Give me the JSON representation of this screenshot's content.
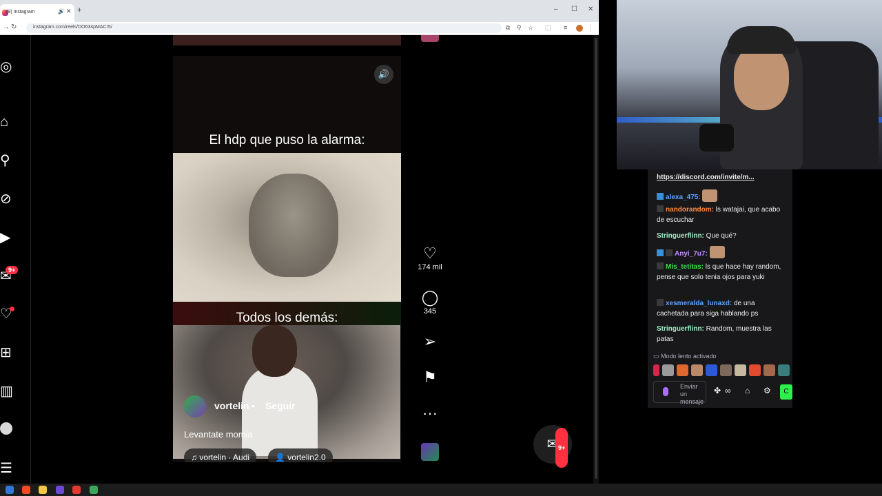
{
  "browser": {
    "tab_title": "(9) Instagram",
    "url": "instagram.com/reels/DO634pMACr5/",
    "new_tab": "+",
    "controls": {
      "minimize": "–",
      "maximize": "☐",
      "close": "✕"
    }
  },
  "sidebar": {
    "notifications_badge": "9+"
  },
  "reel": {
    "top_text": "El hdp que puso la alarma:",
    "bottom_text": "Todos los demás:",
    "username": "vortelin",
    "separator": "•",
    "follow_label": "Seguir",
    "caption": "Levantate momia",
    "audio_label": "vortelin · Audi",
    "tagged_user": "vortelin2.0"
  },
  "actions": {
    "likes": "174 mil",
    "comments": "345"
  },
  "messages": {
    "badge": "9+"
  },
  "chat": {
    "pinned_link": "https://discord.com/invite/m...",
    "messages": [
      {
        "user": "alexa_475:",
        "text": ""
      },
      {
        "user": "nandorandom:",
        "text": "ls watajai, que acabo de escuchar"
      },
      {
        "user": "Stringuerflinn:",
        "text": "Que qué?"
      },
      {
        "user": "Anyi_7u7:",
        "text": ""
      },
      {
        "user": "Mis_tetitas:",
        "text": "ls que hace hay random, pense que solo tenia ojos para yuki"
      },
      {
        "user": "xesmeralda_lunaxd:",
        "text": "de una cachetada para siga hablando ps"
      },
      {
        "user": "Stringuerflinn:",
        "text": "Random, muestra las patas"
      }
    ],
    "slow_mode": "Modo lento activado",
    "input_placeholder": "Enviar un mensaje",
    "send_label": "C"
  },
  "colors": {
    "chat_bg": "#18181b",
    "like_badge": "#ff3040",
    "twitch_accent": "#a970ff",
    "send_green": "#2ef04a"
  }
}
